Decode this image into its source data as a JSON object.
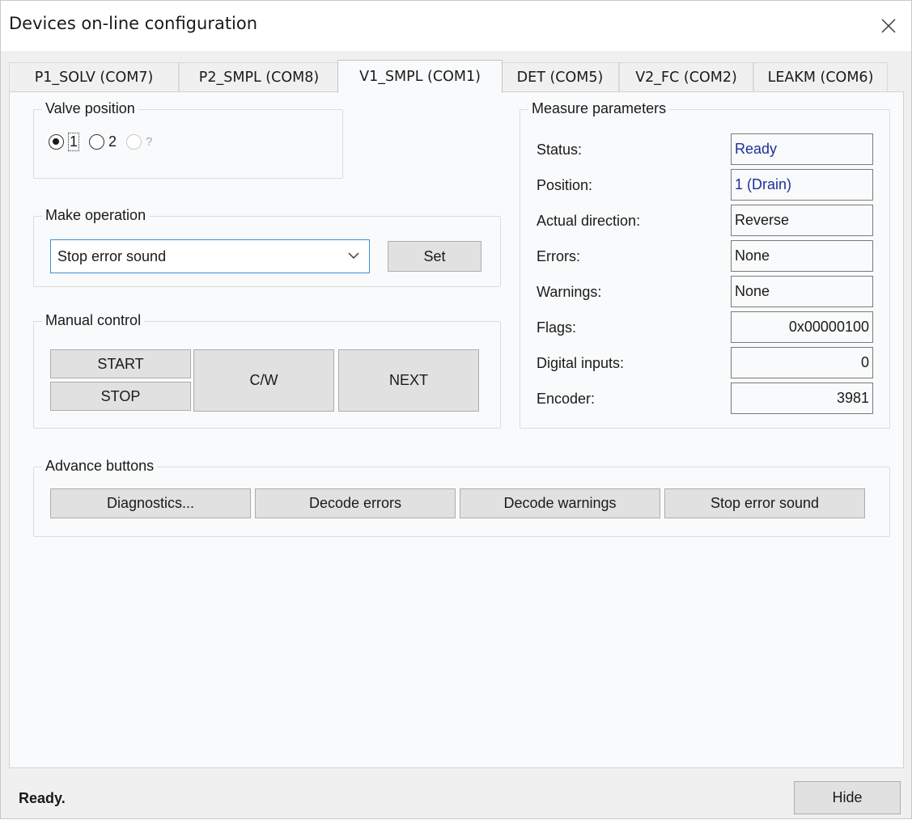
{
  "window": {
    "title": "Devices on-line configuration"
  },
  "tabs": [
    {
      "label": "P1_SOLV (COM7)",
      "active": false
    },
    {
      "label": "P2_SMPL (COM8)",
      "active": false
    },
    {
      "label": "V1_SMPL (COM1)",
      "active": true
    },
    {
      "label": "DET (COM5)",
      "active": false
    },
    {
      "label": "V2_FC (COM2)",
      "active": false
    },
    {
      "label": "LEAKM (COM6)",
      "active": false
    }
  ],
  "valve_position": {
    "label": "Valve position",
    "options": [
      {
        "label": "1",
        "checked": true,
        "disabled": false
      },
      {
        "label": "2",
        "checked": false,
        "disabled": false
      },
      {
        "label": "?",
        "checked": false,
        "disabled": true
      }
    ]
  },
  "make_operation": {
    "label": "Make operation",
    "selected": "Stop error sound",
    "set_label": "Set"
  },
  "manual_control": {
    "label": "Manual control",
    "start": "START",
    "stop": "STOP",
    "cw": "C/W",
    "next": "NEXT"
  },
  "measure_parameters": {
    "label": "Measure parameters",
    "rows": [
      {
        "label": "Status:",
        "value": "Ready"
      },
      {
        "label": "Position:",
        "value": "1 (Drain)"
      },
      {
        "label": "Actual direction:",
        "value": "Reverse"
      },
      {
        "label": "Errors:",
        "value": "None"
      },
      {
        "label": "Warnings:",
        "value": "None"
      },
      {
        "label": "Flags:",
        "value": "0x00000100"
      },
      {
        "label": "Digital inputs:",
        "value": "0"
      },
      {
        "label": "Encoder:",
        "value": "3981"
      }
    ]
  },
  "advance_buttons": {
    "label": "Advance buttons",
    "diagnostics": "Diagnostics...",
    "decode_errors": "Decode errors",
    "decode_warnings": "Decode warnings",
    "stop_error_sound": "Stop error sound"
  },
  "statusbar": {
    "text": "Ready.",
    "hide_label": "Hide"
  },
  "colors": {
    "value_blue": "#1f2f9c",
    "focus_border": "#3b8fd6"
  }
}
